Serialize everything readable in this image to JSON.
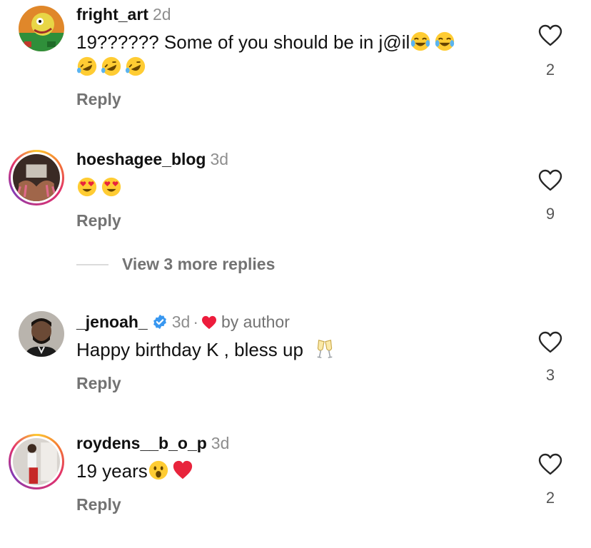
{
  "comments": [
    {
      "username": "fright_art",
      "time": "2d",
      "text_line1": "19?????? Some of you should be in j@il",
      "emojis_line1": [
        "face-with-tears-of-joy",
        "face-with-tears-of-joy"
      ],
      "emojis_line2": [
        "rolling-on-floor-laughing",
        "rolling-on-floor-laughing",
        "rolling-on-floor-laughing"
      ],
      "reply_label": "Reply",
      "like_count": "2"
    },
    {
      "username": "hoeshagee_blog",
      "time": "3d",
      "text": "",
      "emojis": [
        "smiling-face-with-heart-eyes",
        "smiling-face-with-heart-eyes"
      ],
      "reply_label": "Reply",
      "like_count": "9",
      "view_more_label": "View 3 more replies"
    },
    {
      "username": "_jenoah_",
      "time": "3d",
      "dot": "·",
      "by_author": "by author",
      "text": "Happy birthday K , bless up",
      "emojis": [
        "clinking-glasses"
      ],
      "reply_label": "Reply",
      "like_count": "3"
    },
    {
      "username": "roydens__b_o_p",
      "time": "3d",
      "text": "19 years",
      "emojis": [
        "face-with-open-mouth",
        "red-heart"
      ],
      "reply_label": "Reply",
      "like_count": "2"
    }
  ],
  "colors": {
    "username": "#111111",
    "meta": "#8e8e8e",
    "reply": "#737373",
    "verified": "#3897f0",
    "author_heart": "#ed1c3c"
  }
}
